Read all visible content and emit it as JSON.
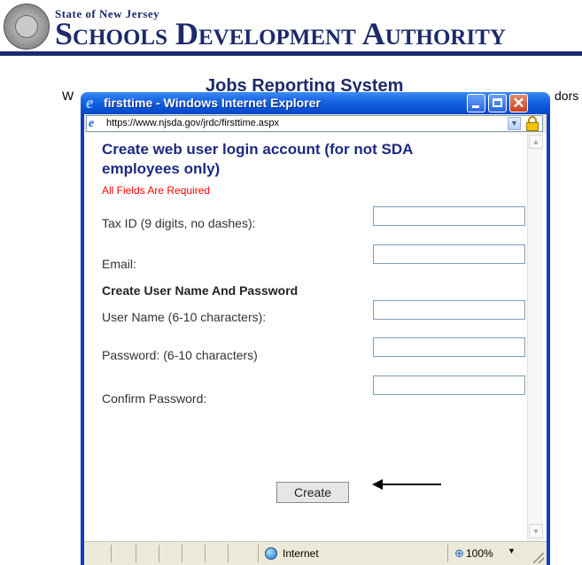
{
  "page": {
    "state_line": "State of New Jersey",
    "authority_line": "Schools Development Authority",
    "bg_title": "Jobs Reporting System",
    "bg_left_text": "W",
    "bg_right_text": "dors"
  },
  "window": {
    "title": "firsttime - Windows Internet Explorer",
    "controls": {
      "minimize": "_",
      "maximize": "□",
      "close": "✕"
    },
    "address": {
      "url": "https://www.njsda.gov/jrdc/firsttime.aspx"
    }
  },
  "form": {
    "heading": "Create web user login account (for not SDA employees only)",
    "required_note": "All Fields Are Required",
    "fields": {
      "tax_id_label": "Tax ID (9 digits, no dashes):",
      "tax_id_value": "",
      "email_label": "Email:",
      "email_value": "",
      "section_heading": "Create User Name And Password",
      "username_label": "User Name (6-10 characters):",
      "username_value": "",
      "password_label": "Password: (6-10 characters)",
      "password_value": "",
      "confirm_label": "Confirm Password:",
      "confirm_value": ""
    },
    "create_button": "Create"
  },
  "statusbar": {
    "left_text": "",
    "zone": "Internet",
    "zoom": "100%"
  },
  "colors": {
    "brand_navy": "#1d2a6b",
    "xp_title_blue": "#0a54d8",
    "required_red": "#ff0000",
    "heading_blue": "#1d2a80"
  },
  "icons": [
    "ie-logo-icon",
    "page-icon",
    "dropdown-icon",
    "lock-icon",
    "globe-icon",
    "zoom-icon",
    "resize-grip-icon",
    "arrow-icon",
    "seal-icon"
  ]
}
